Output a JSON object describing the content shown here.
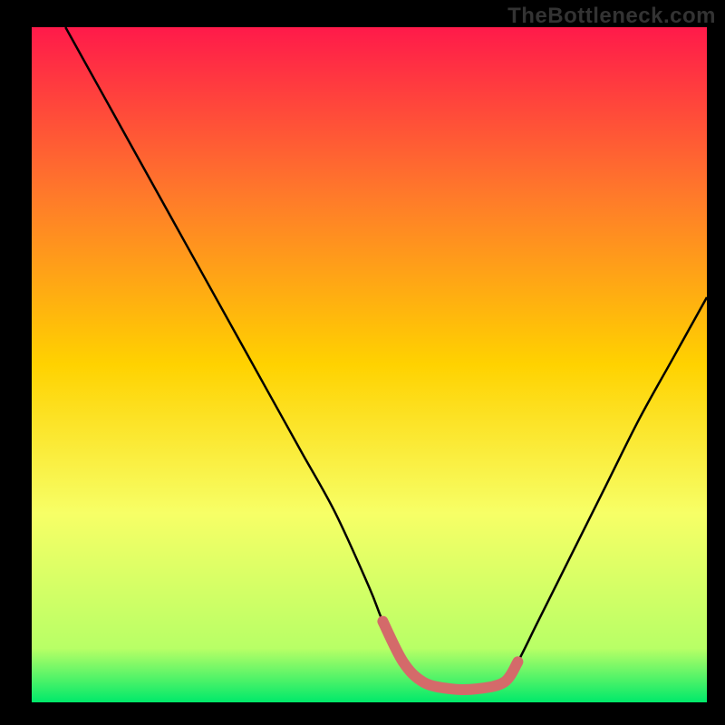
{
  "watermark": "TheBottleneck.com",
  "chart_data": {
    "type": "line",
    "title": "",
    "xlabel": "",
    "ylabel": "",
    "xlim": [
      0,
      100
    ],
    "ylim": [
      0,
      100
    ],
    "grid": false,
    "legend": false,
    "annotations": [],
    "background_gradient": {
      "top_color": "#ff1a4a",
      "mid_color": "#ffd200",
      "bottom_color": "#00e96a"
    },
    "series": [
      {
        "name": "curve",
        "color": "#000000",
        "x": [
          5,
          10,
          15,
          20,
          25,
          30,
          35,
          40,
          45,
          50,
          52,
          55,
          58,
          62,
          66,
          70,
          72,
          75,
          80,
          85,
          90,
          95,
          100
        ],
        "values": [
          100,
          91,
          82,
          73,
          64,
          55,
          46,
          37,
          28,
          17,
          12,
          6,
          3,
          2,
          2,
          3,
          6,
          12,
          22,
          32,
          42,
          51,
          60
        ]
      },
      {
        "name": "highlight-band",
        "color": "#d46a6a",
        "x": [
          52,
          55,
          58,
          62,
          66,
          70,
          72
        ],
        "values": [
          12,
          6,
          3,
          2,
          2,
          3,
          6
        ]
      }
    ]
  }
}
